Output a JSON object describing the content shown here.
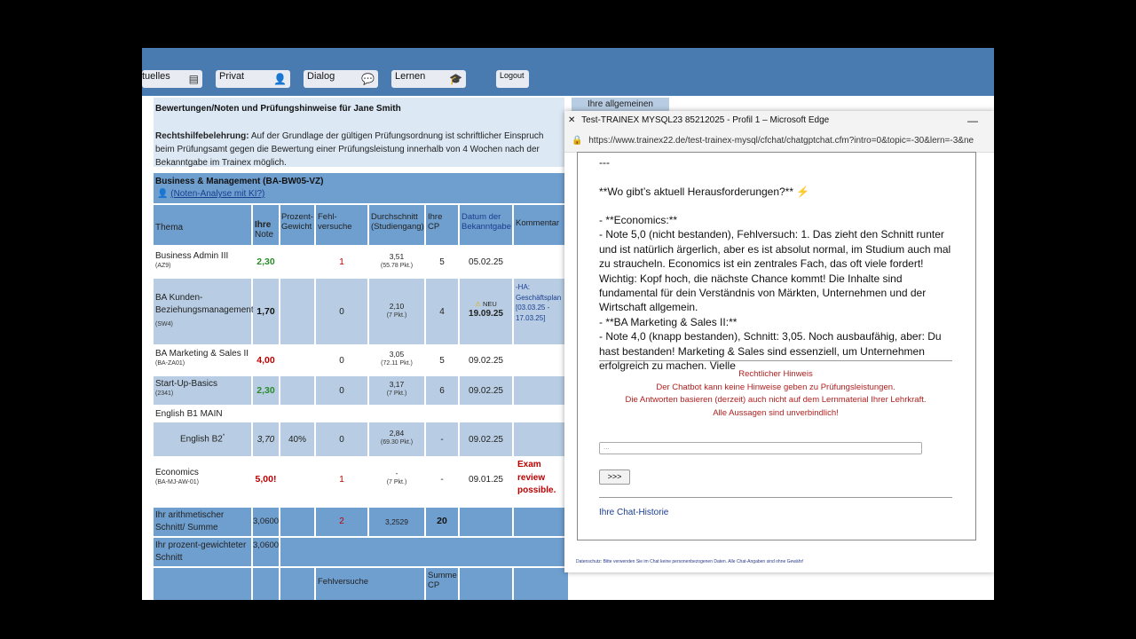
{
  "nav": {
    "aktuelles": "tuelles",
    "privat": "Privat",
    "dialog": "Dialog",
    "lernen": "Lernen",
    "logout": "Logout",
    "tab_general": "Ihre allgemeinen"
  },
  "header": {
    "title": "Bewertungen/Noten und Prüfungshinweise für Jane Smith",
    "legal_label": "Rechtshilfebelehrung:",
    "legal_text": "Auf der Grundlage der gültigen Prüfungsordnung ist schriftlicher Einspruch beim Prüfungsamt gegen die Bewertung einer Prüfungsleistung innerhalb von 4 Wochen nach der Bekanntgabe im Trainex möglich."
  },
  "program": {
    "title": "Business & Management (BA-BW05-VZ)",
    "link": "(Noten-Analyse mit KI?)"
  },
  "table": {
    "headers": {
      "thema": "Thema",
      "note_1": "Ihre",
      "note_2": "Note",
      "gewicht_1": "Prozent-",
      "gewicht_2": "Gewicht",
      "fehl_1": "Fehl-",
      "fehl_2": "versuche",
      "schnitt_1": "Durchschnitt",
      "schnitt_2": "(Studiengang)",
      "cp_1": "Ihre",
      "cp_2": "CP",
      "datum_1": "Datum der",
      "datum_2": "Bekanntgabe",
      "kommentar": "Kommentar"
    },
    "rows": [
      {
        "name": "Business Admin III",
        "code": "(AZ9)",
        "note": "2,30",
        "fehl": "1",
        "schnitt": "3,51",
        "pkt": "(55.78 Pkt.)",
        "cp": "5",
        "datum": "05.02.25"
      },
      {
        "name": "BA Kunden-Beziehungsmanagement",
        "code": "(SW4)",
        "note": "1,70",
        "fehl": "0",
        "schnitt": "2,10",
        "pkt": "(7 Pkt.)",
        "cp": "4",
        "neu": "NEU",
        "datum": "19.09.25",
        "kommentar": "-HA: Geschäftsplan [03.03.25 - 17.03.25]"
      },
      {
        "name": "BA Marketing & Sales II",
        "code": "(BA-ZA01)",
        "note": "4,00",
        "fehl": "0",
        "schnitt": "3,05",
        "pkt": "(72.11 Pkt.)",
        "cp": "5",
        "datum": "09.02.25"
      },
      {
        "name": "Start-Up-Basics",
        "code": "(2341)",
        "note": "2,30",
        "fehl": "0",
        "schnitt": "3,17",
        "pkt": "(7 Pkt.)",
        "cp": "6",
        "datum": "09.02.25"
      },
      {
        "name": "English B1 MAIN"
      },
      {
        "name": "English B2",
        "sup": "*",
        "note": "3,70",
        "gewicht": "40%",
        "fehl": "0",
        "schnitt": "2,84",
        "pkt": "(69.30 Pkt.)",
        "cp": "-",
        "datum": "09.02.25"
      },
      {
        "name": "Economics",
        "code": "(BA-MJ-AW-01)",
        "note": "5,00!",
        "fehl": "1",
        "schnitt": "-",
        "pkt": "(7 Pkt.)",
        "cp": "-",
        "datum": "09.01.25",
        "kommentar": "Exam review possible."
      }
    ],
    "summary": {
      "arith_label": "Ihr arithmetischer Schnitt/ Summe",
      "arith_value": "3,0600",
      "arith_fehl": "2",
      "arith_schnitt": "3,2529",
      "arith_cp": "20",
      "weighted_label": "Ihr prozent-gewichteter Schnitt",
      "weighted_value": "3,0600",
      "footer_fehl": "Fehlversuche",
      "footer_cp_1": "Summe",
      "footer_cp_2": "CP"
    }
  },
  "chat": {
    "window_title": "Test-TRAINEX MYSQL23 85212025 - Profil 1 – Microsoft Edge",
    "url": "https://www.trainex22.de/test-trainex-mysql/cfchat/chatgptchat.cfm?intro=0&topic=-30&lern=-3&ne",
    "separator": "---",
    "heading": "**Wo gibt’s aktuell Herausforderungen?**",
    "heading_emoji": "⚡",
    "lines": [
      "- **Economics:**",
      "- Note 5,0 (nicht bestanden), Fehlversuch: 1. Das zieht den Schnitt runter und ist natürlich ärgerlich, aber es ist absolut normal, im Studium auch mal zu straucheln. Economics ist ein zentrales Fach, das oft viele fordert! Wichtig: Kopf hoch, die nächste Chance kommt! Die Inhalte sind fundamental für dein Verständnis von Märkten, Unternehmen und der Wirtschaft allgemein.",
      "- **BA Marketing & Sales II:**",
      "- Note 4,0 (knapp bestanden), Schnitt: 3,05. Noch ausbaufähig, aber: Du hast bestanden! Marketing & Sales sind essenziell, um Unternehmen erfolgreich zu machen. Vielle"
    ],
    "hint_title": "Rechtlicher Hinweis",
    "hint_1": "Der Chatbot kann keine Hinweise geben zu Prüfungsleistungen.",
    "hint_2": "Die Antworten basieren (derzeit) auch nicht auf dem Lernmaterial Ihrer Lehrkraft.",
    "hint_3": "Alle Aussagen sind unverbindlich!",
    "input_placeholder": "...",
    "send_label": ">>>",
    "history_link": "Ihre Chat-Historie",
    "privacy": "Datenschutz: Bitte verwenden Sie im Chat keine personenbezogenen Daten. Alle Chat-Angaben sind ohne Gewähr!"
  }
}
